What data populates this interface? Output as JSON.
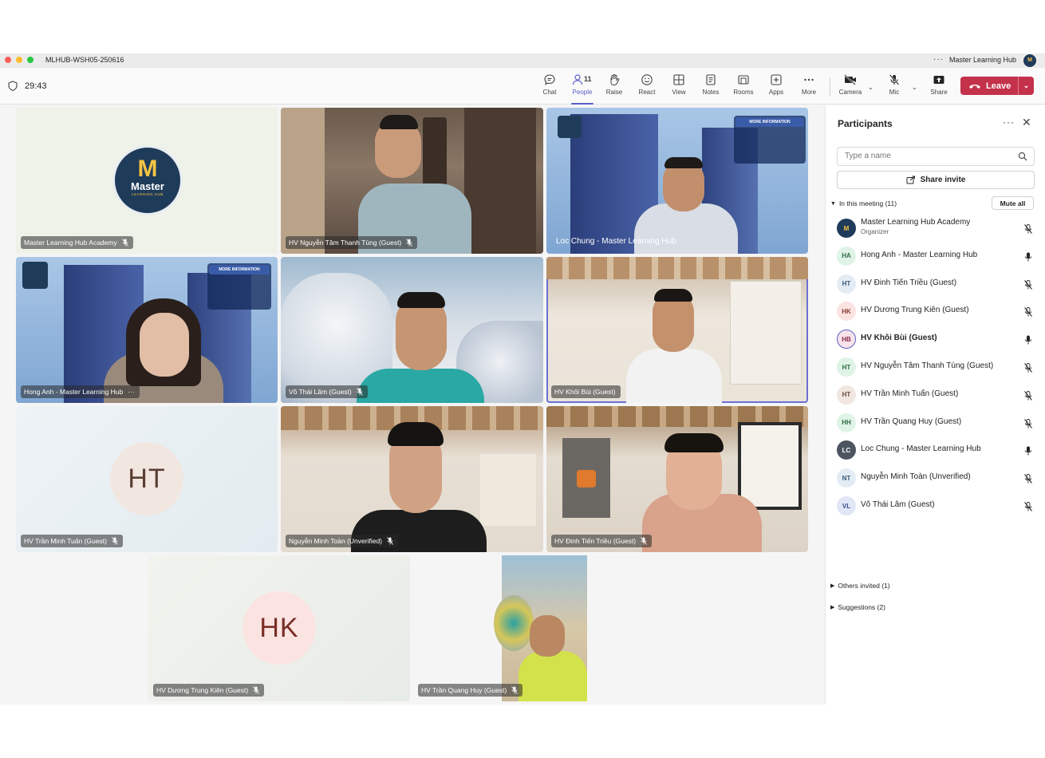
{
  "window": {
    "title": "MLHUB-WSH05-250616",
    "org_name": "Master Learning Hub",
    "org_avatar": "M"
  },
  "toolbar": {
    "timer": "29:43",
    "chat": "Chat",
    "people": "People",
    "people_count": "11",
    "raise": "Raise",
    "react": "React",
    "view": "View",
    "notes": "Notes",
    "rooms": "Rooms",
    "apps": "Apps",
    "more": "More",
    "camera": "Camera",
    "mic": "Mic",
    "share": "Share",
    "leave": "Leave"
  },
  "tiles": [
    {
      "name": "Master Learning Hub Academy"
    },
    {
      "name": "HV Nguyễn Tâm Thanh Tùng (Guest)"
    },
    {
      "name": "Loc Chung - Master Learning Hub"
    },
    {
      "name": "Hong Anh - Master Learning Hub"
    },
    {
      "name": "Võ Thái Lâm (Guest)"
    },
    {
      "name": "HV Khôi Bùi (Guest)"
    },
    {
      "name": "HV Trần Minh Tuấn (Guest)",
      "initials": "HT"
    },
    {
      "name": "Nguyễn Minh Toàn (Unverified)"
    },
    {
      "name": "HV Đinh Tiến Triều (Guest)"
    },
    {
      "name": "HV Dương Trung Kiên (Guest)",
      "initials": "HK"
    },
    {
      "name": "HV Trần Quang Huy (Guest)"
    }
  ],
  "logo": {
    "letter": "M",
    "word": "Master",
    "sub": "LEARNING HUB"
  },
  "banner": {
    "more_info": "MORE INFORMATION"
  },
  "panel": {
    "title": "Participants",
    "search_placeholder": "Type a name",
    "share_invite": "Share invite",
    "in_meeting": "In this meeting (11)",
    "mute_all": "Mute all",
    "others_invited": "Others invited (1)",
    "suggestions": "Suggestions (2)",
    "participants": [
      {
        "initials": "M",
        "name": "Master Learning Hub Academy",
        "role": "Organizer",
        "color": "#1f3b5a",
        "fg": "#f6c343"
      },
      {
        "initials": "HA",
        "name": "Hong Anh - Master Learning Hub",
        "color": "#dff3e6",
        "fg": "#2f6b46"
      },
      {
        "initials": "HT",
        "name": "HV Đinh Tiến Triều (Guest)",
        "color": "#e3ecf4",
        "fg": "#3a5a78"
      },
      {
        "initials": "HK",
        "name": "HV Dương Trung Kiên (Guest)",
        "color": "#fbe3e1",
        "fg": "#8a3a33"
      },
      {
        "initials": "HB",
        "name": "HV Khôi Bùi (Guest)",
        "color": "#f7e4ea",
        "fg": "#8a2c4a"
      },
      {
        "initials": "HT",
        "name": "HV Nguyễn Tâm Thanh Tùng (Guest)",
        "color": "#dff3e6",
        "fg": "#2f6b46"
      },
      {
        "initials": "HT",
        "name": "HV Trần Minh Tuấn (Guest)",
        "color": "#f2e6e1",
        "fg": "#6b4a3d"
      },
      {
        "initials": "HH",
        "name": "HV Trần Quang Huy (Guest)",
        "color": "#dff3e6",
        "fg": "#2f6b46"
      },
      {
        "initials": "LC",
        "name": "Loc Chung - Master Learning Hub",
        "color": "#4d5560",
        "fg": "#ffffff"
      },
      {
        "initials": "NT",
        "name": "Nguyễn Minh Toàn (Unverified)",
        "color": "#e3ecf4",
        "fg": "#3a5a78"
      },
      {
        "initials": "VL",
        "name": "Võ Thái Lâm (Guest)",
        "color": "#e1e6f6",
        "fg": "#3a4a8a"
      }
    ]
  }
}
